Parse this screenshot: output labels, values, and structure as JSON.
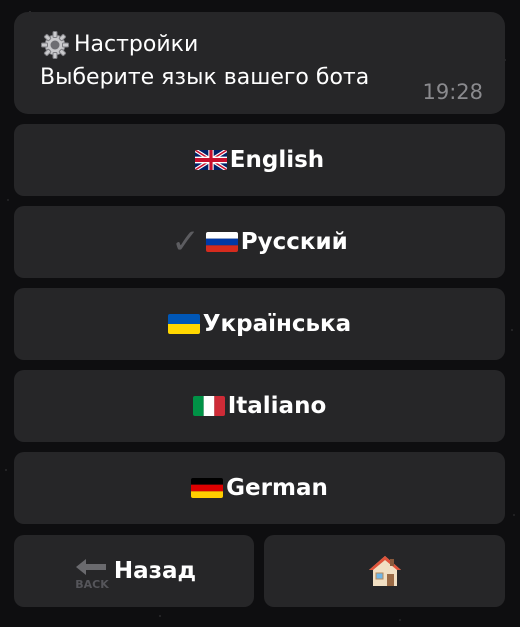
{
  "message": {
    "title": "Настройки",
    "text": "Выберите язык вашего бота",
    "time": "19:28",
    "title_icon": "gear-icon"
  },
  "languages": [
    {
      "label": "English",
      "flag": "uk-flag-icon"
    },
    {
      "label": "Русский",
      "flag": "russia-flag-icon",
      "selected": true,
      "check_icon": "check-icon"
    },
    {
      "label": "Українська",
      "flag": "ukraine-flag-icon"
    },
    {
      "label": "Italiano",
      "flag": "italy-flag-icon"
    },
    {
      "label": "German",
      "flag": "germany-flag-icon"
    }
  ],
  "nav": {
    "back_label": "Назад",
    "back_icon_text": "BACK",
    "back_icon": "back-arrow-icon",
    "home_icon": "home-icon"
  },
  "colors": {
    "background": "#0e0e10",
    "bubble": "#262628",
    "button": "#262628",
    "text": "#ffffff",
    "time": "#8a8a8e",
    "check": "#5c5c60"
  }
}
